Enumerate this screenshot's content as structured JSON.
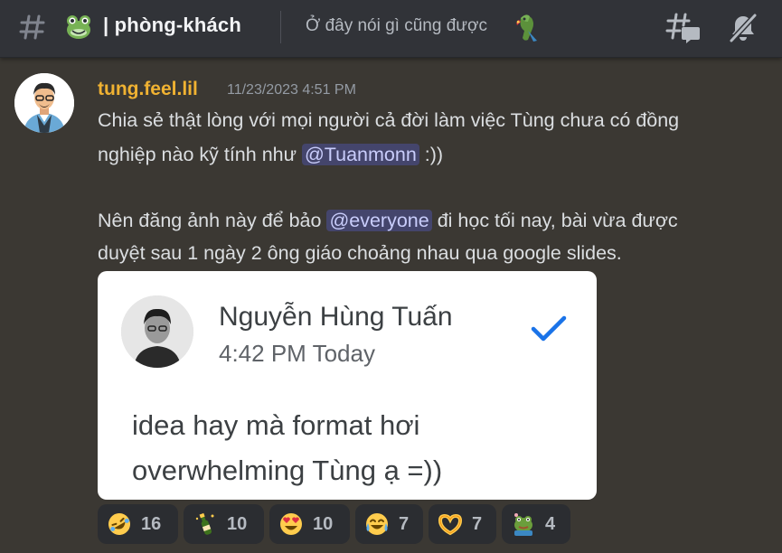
{
  "header": {
    "channel_name": "| phòng-khách",
    "channel_topic": "Ở đây nói gì cũng được"
  },
  "message": {
    "username": "tung.feel.lil",
    "timestamp": "11/23/2023 4:51 PM",
    "line1": "Chia sẻ thật lòng với mọi người cả đời làm việc Tùng chưa có đồng",
    "line2_prefix": "nghiệp nào kỹ tính như ",
    "mention_user": "@Tuanmonn",
    "line2_suffix": " :))",
    "line3_prefix": "Nên đăng ảnh này để bảo ",
    "mention_everyone": "@everyone",
    "line3_suffix": " đi học tối nay, bài vừa được",
    "line4": "duyệt sau 1 ngày 2 ông giáo choảng nhau qua google slides."
  },
  "attachment": {
    "author_name": "Nguyễn Hùng Tuấn",
    "time": "4:42 PM Today",
    "comment_line1": "idea hay mà format hơi",
    "comment_line2": "overwhelming Tùng ạ =))"
  },
  "reactions": [
    {
      "emoji": "rofl",
      "count": "16"
    },
    {
      "emoji": "champagne",
      "count": "10"
    },
    {
      "emoji": "heart-eyes",
      "count": "10"
    },
    {
      "emoji": "joy",
      "count": "7"
    },
    {
      "emoji": "heart-hands",
      "count": "7"
    },
    {
      "emoji": "pepe-frog",
      "count": "4"
    }
  ],
  "colors": {
    "username": "#f0b232",
    "mention_bg": "#4a4f8a",
    "background": "#3b3833",
    "header": "#313338"
  },
  "icons": [
    "hash-icon",
    "frog-emoji-icon",
    "parrot-emoji-icon",
    "threads-icon",
    "mute-icon",
    "checkmark-icon"
  ]
}
